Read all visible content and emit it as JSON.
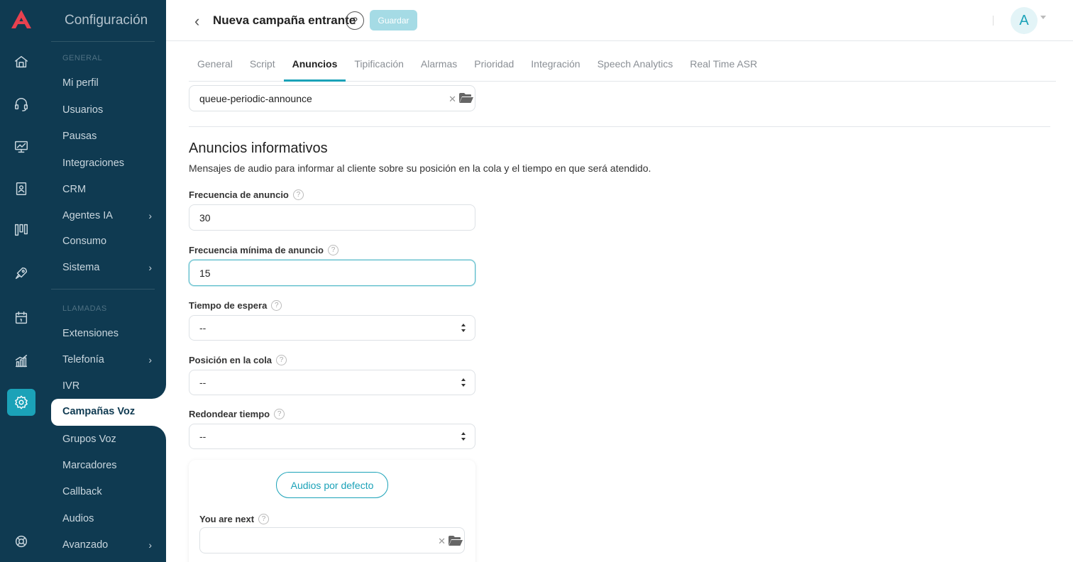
{
  "sidebar": {
    "title": "Configuración",
    "section_general": "GENERAL",
    "section_calls": "LLAMADAS",
    "items_general": [
      {
        "label": "Mi perfil",
        "chevron": false
      },
      {
        "label": "Usuarios",
        "chevron": false
      },
      {
        "label": "Pausas",
        "chevron": false
      },
      {
        "label": "Integraciones",
        "chevron": false
      },
      {
        "label": "CRM",
        "chevron": false
      },
      {
        "label": "Agentes IA",
        "chevron": true
      },
      {
        "label": "Consumo",
        "chevron": false
      },
      {
        "label": "Sistema",
        "chevron": true
      }
    ],
    "items_calls": [
      {
        "label": "Extensiones",
        "chevron": false
      },
      {
        "label": "Telefonía",
        "chevron": true
      },
      {
        "label": "IVR",
        "chevron": false
      },
      {
        "label": "Campañas Voz",
        "chevron": false,
        "active": true
      },
      {
        "label": "Grupos Voz",
        "chevron": false
      },
      {
        "label": "Marcadores",
        "chevron": false
      },
      {
        "label": "Callback",
        "chevron": false
      },
      {
        "label": "Audios",
        "chevron": false
      },
      {
        "label": "Avanzado",
        "chevron": true
      }
    ]
  },
  "rail_icons": [
    "home-icon",
    "headset-icon",
    "monitor-icon",
    "contacts-icon",
    "columns-icon",
    "rocket-icon",
    "calendar-icon",
    "analytics-icon",
    "settings-icon",
    "support-icon"
  ],
  "header": {
    "title": "Nueva campaña entrante",
    "help": "?",
    "save_label": "Guardar",
    "avatar_initial": "A"
  },
  "tabs": [
    {
      "label": "General"
    },
    {
      "label": "Script"
    },
    {
      "label": "Anuncios",
      "active": true
    },
    {
      "label": "Tipificación"
    },
    {
      "label": "Alarmas"
    },
    {
      "label": "Prioridad"
    },
    {
      "label": "Integración"
    },
    {
      "label": "Speech Analytics"
    },
    {
      "label": "Real Time ASR"
    }
  ],
  "form": {
    "periodic_file": "queue-periodic-announce",
    "section_title": "Anuncios informativos",
    "section_desc": "Mensajes de audio para informar al cliente sobre su posición en la cola y el tiempo en que será atendido.",
    "freq_label": "Frecuencia de anuncio",
    "freq_value": "30",
    "min_freq_label": "Frecuencia mínima de anuncio",
    "min_freq_value": "15",
    "wait_label": "Tiempo de espera",
    "wait_value": "--",
    "position_label": "Posición en la cola",
    "position_value": "--",
    "round_label": "Redondear tiempo",
    "round_value": "--",
    "default_audios_btn": "Audios por defecto",
    "you_are_next_label": "You are next",
    "you_are_next_value": ""
  },
  "colors": {
    "sidebar_bg": "#0f3a51",
    "accent": "#1ba2b8",
    "logo": "#e8414f"
  }
}
